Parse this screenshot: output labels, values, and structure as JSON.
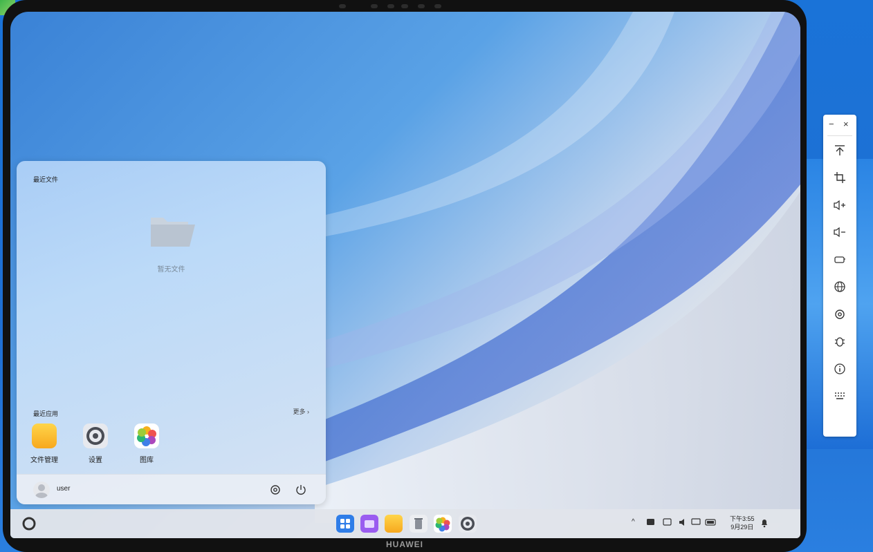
{
  "device": {
    "brand": "HUAWEI"
  },
  "start_menu": {
    "recent_files": {
      "title": "最近文件",
      "empty_text": "暂无文件"
    },
    "recent_apps": {
      "title": "最近应用",
      "more": "更多 ›",
      "apps": [
        {
          "label": "文件管理",
          "icon": "folder-icon"
        },
        {
          "label": "设置",
          "icon": "settings-icon"
        },
        {
          "label": "图库",
          "icon": "gallery-icon"
        }
      ]
    },
    "user": {
      "name": "user"
    }
  },
  "taskbar": {
    "apps": [
      "launcher-icon",
      "multitask-icon",
      "files-icon",
      "trash-icon",
      "gallery-icon",
      "settings-icon"
    ],
    "clock": {
      "time": "下午3:55",
      "date": "9月29日"
    }
  },
  "side_toolbar": {
    "minimize": "−",
    "close": "×",
    "tools": [
      "upload-icon",
      "crop-icon",
      "volume-up-icon",
      "volume-down-icon",
      "power-icon",
      "globe-icon",
      "gear-icon",
      "bug-icon",
      "info-icon",
      "keyboard-icon"
    ]
  },
  "colors": {
    "accent": "#1f6fd2",
    "folder": "#f7b928"
  }
}
